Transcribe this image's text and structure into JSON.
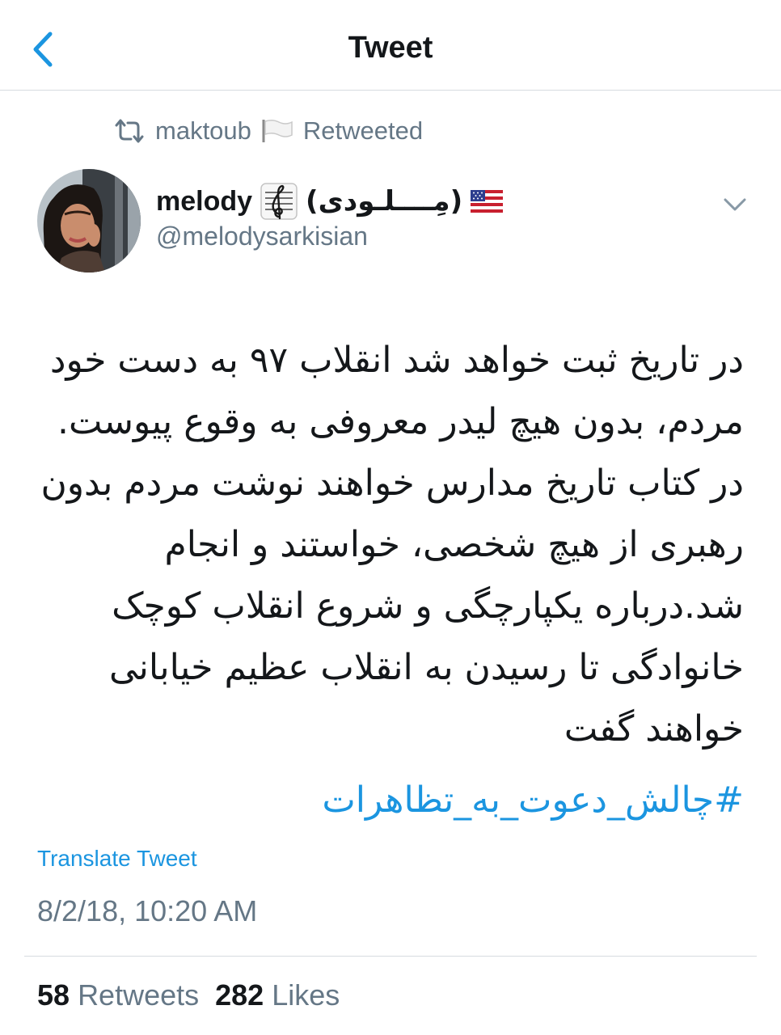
{
  "nav": {
    "title": "Tweet"
  },
  "retweet_context": {
    "user": "maktoub",
    "label": "Retweeted"
  },
  "author": {
    "name": "melody",
    "name_suffix": "(مِــــلـودی)",
    "handle": "@melodysarkisian"
  },
  "tweet": {
    "lines": [
      "در تاریخ ثبت خواهد شد انقلاب ۹۷ به دست خود",
      "مردم، بدون هیچ لیدر معروفی به وقوع پیوست.",
      "در کتاب تاریخ مدارس خواهند نوشت مردم بدون",
      "رهبری از هیچ شخصی، خواستند و انجام",
      "شد.درباره یکپارچگی و شروع انقلاب کوچک",
      "خانوادگی تا رسیدن به انقلاب عظیم خیابانی",
      "خواهند گفت"
    ],
    "hashtag": "#چالش_دعوت_به_تظاهرات",
    "translate_label": "Translate Tweet",
    "timestamp": "8/2/18, 10:20 AM"
  },
  "stats": {
    "retweets_count": "58",
    "retweets_label": "Retweets",
    "likes_count": "282",
    "likes_label": "Likes"
  },
  "icons": {
    "back": "chevron-left-icon",
    "retweet": "retweet-icon",
    "music": "treble-clef-icon",
    "flag": "us-flag-icon",
    "caret": "chevron-down-icon"
  },
  "colors": {
    "accent": "#1b95e0",
    "text_primary": "#14171a",
    "text_secondary": "#657786",
    "divider": "#d6dbe0"
  }
}
